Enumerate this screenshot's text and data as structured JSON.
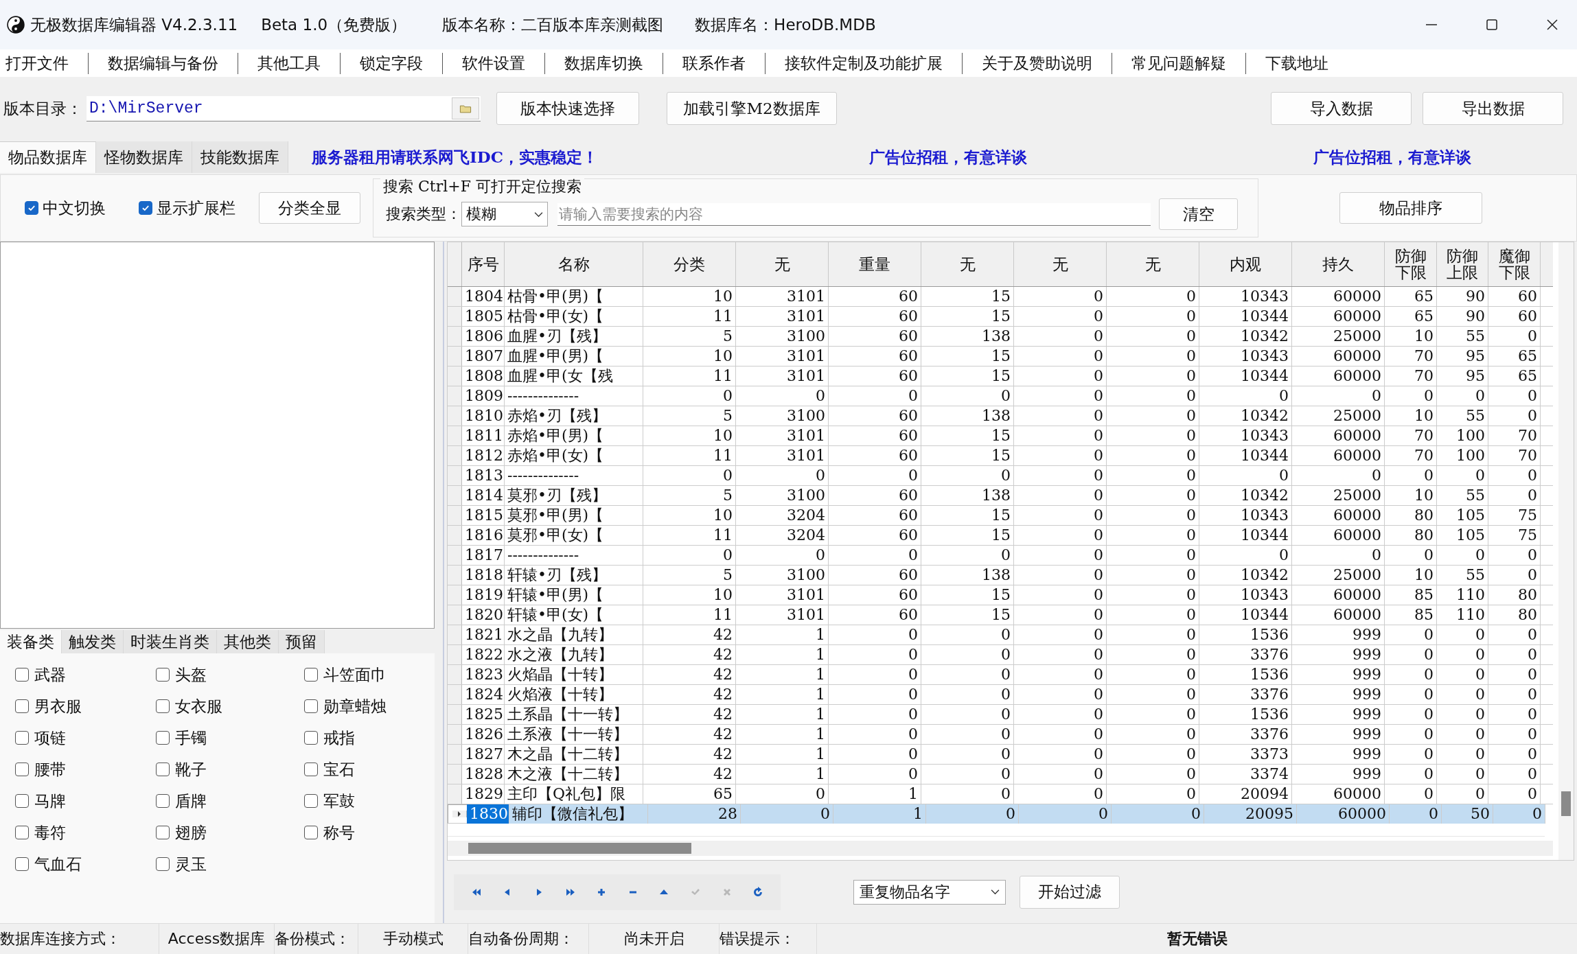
{
  "window": {
    "title": "无极数据库编辑器 V4.2.3.11",
    "edition": "Beta 1.0（免费版）",
    "version_name": "版本名称：二百版本库亲测截图",
    "database_name": "数据库名：HeroDB.MDB"
  },
  "menu": [
    "打开文件",
    "数据编辑与备份",
    "其他工具",
    "锁定字段",
    "软件设置",
    "数据库切换",
    "联系作者",
    "接软件定制及功能扩展",
    "关于及赞助说明",
    "常见问题解疑",
    "下载地址"
  ],
  "path_bar": {
    "label": "版本目录：",
    "value": "D:\\MirServer",
    "quick_select_button": "版本快速选择",
    "load_button": "加载引擎M2数据库",
    "import_button": "导入数据",
    "export_button": "导出数据"
  },
  "tabs": [
    {
      "label": "物品数据库",
      "selected": true
    },
    {
      "label": "怪物数据库",
      "selected": false
    },
    {
      "label": "技能数据库",
      "selected": false
    }
  ],
  "ads": [
    "服务器租用请联系网飞IDC，实惠稳定！",
    "广告位招租，有意详谈",
    "广告位招租，有意详谈"
  ],
  "options": {
    "checkboxes": [
      {
        "label": "中文切换",
        "checked": true
      },
      {
        "label": "显示扩展栏",
        "checked": true
      }
    ],
    "show_all_button": "分类全显"
  },
  "search": {
    "title": "搜索  Ctrl+F 可打开定位搜索",
    "type_label": "搜索类型：",
    "type_value": "模糊",
    "placeholder": "请输入需要搜索的内容",
    "clear_button": "清空"
  },
  "sort_button": "物品排序",
  "category_tabs": [
    {
      "label": "装备类",
      "selected": true
    },
    {
      "label": "触发类",
      "selected": false
    },
    {
      "label": "时装生肖类",
      "selected": false
    },
    {
      "label": "其他类",
      "selected": false
    },
    {
      "label": "预留",
      "selected": false
    }
  ],
  "categories": [
    {
      "label": "武器",
      "checked": false
    },
    {
      "label": "头盔",
      "checked": false
    },
    {
      "label": "斗笠面巾",
      "checked": false
    },
    {
      "label": "男衣服",
      "checked": false
    },
    {
      "label": "女衣服",
      "checked": false
    },
    {
      "label": "勋章蜡烛",
      "checked": false
    },
    {
      "label": "项链",
      "checked": false
    },
    {
      "label": "手镯",
      "checked": false
    },
    {
      "label": "戒指",
      "checked": false
    },
    {
      "label": "腰带",
      "checked": false
    },
    {
      "label": "靴子",
      "checked": false
    },
    {
      "label": "宝石",
      "checked": false
    },
    {
      "label": "马牌",
      "checked": false
    },
    {
      "label": "盾牌",
      "checked": false
    },
    {
      "label": "军鼓",
      "checked": false
    },
    {
      "label": "毒符",
      "checked": false
    },
    {
      "label": "翅膀",
      "checked": false
    },
    {
      "label": "称号",
      "checked": false
    },
    {
      "label": "气血石",
      "checked": false
    },
    {
      "label": "灵玉",
      "checked": false
    }
  ],
  "table": {
    "columns": [
      "序号",
      "名称",
      "分类",
      "无",
      "重量",
      "无",
      "无",
      "无",
      "内观",
      "持久",
      "防御下限",
      "防御上限",
      "魔御下限"
    ],
    "rows": [
      {
        "selected": false,
        "cells": [
          "1804",
          "枯骨•甲(男)【",
          "10",
          "3101",
          "60",
          "15",
          "0",
          "0",
          "10343",
          "60000",
          "65",
          "90",
          "60"
        ]
      },
      {
        "selected": false,
        "cells": [
          "1805",
          "枯骨•甲(女)【",
          "11",
          "3101",
          "60",
          "15",
          "0",
          "0",
          "10344",
          "60000",
          "65",
          "90",
          "60"
        ]
      },
      {
        "selected": false,
        "cells": [
          "1806",
          "血腥•刃【残】",
          "5",
          "3100",
          "60",
          "138",
          "0",
          "0",
          "10342",
          "25000",
          "10",
          "55",
          "0"
        ]
      },
      {
        "selected": false,
        "cells": [
          "1807",
          "血腥•甲(男)【",
          "10",
          "3101",
          "60",
          "15",
          "0",
          "0",
          "10343",
          "60000",
          "70",
          "95",
          "65"
        ]
      },
      {
        "selected": false,
        "cells": [
          "1808",
          "血腥•甲(女【残",
          "11",
          "3101",
          "60",
          "15",
          "0",
          "0",
          "10344",
          "60000",
          "70",
          "95",
          "65"
        ]
      },
      {
        "selected": false,
        "cells": [
          "1809",
          "--------------",
          "0",
          "0",
          "0",
          "0",
          "0",
          "0",
          "0",
          "0",
          "0",
          "0",
          "0"
        ]
      },
      {
        "selected": false,
        "cells": [
          "1810",
          "赤焰•刃【残】",
          "5",
          "3100",
          "60",
          "138",
          "0",
          "0",
          "10342",
          "25000",
          "10",
          "55",
          "0"
        ]
      },
      {
        "selected": false,
        "cells": [
          "1811",
          "赤焰•甲(男)【",
          "10",
          "3101",
          "60",
          "15",
          "0",
          "0",
          "10343",
          "60000",
          "70",
          "100",
          "70"
        ]
      },
      {
        "selected": false,
        "cells": [
          "1812",
          "赤焰•甲(女)【",
          "11",
          "3101",
          "60",
          "15",
          "0",
          "0",
          "10344",
          "60000",
          "70",
          "100",
          "70"
        ]
      },
      {
        "selected": false,
        "cells": [
          "1813",
          "--------------",
          "0",
          "0",
          "0",
          "0",
          "0",
          "0",
          "0",
          "0",
          "0",
          "0",
          "0"
        ]
      },
      {
        "selected": false,
        "cells": [
          "1814",
          "莫邪•刃【残】",
          "5",
          "3100",
          "60",
          "138",
          "0",
          "0",
          "10342",
          "25000",
          "10",
          "55",
          "0"
        ]
      },
      {
        "selected": false,
        "cells": [
          "1815",
          "莫邪•甲(男)【",
          "10",
          "3204",
          "60",
          "15",
          "0",
          "0",
          "10343",
          "60000",
          "80",
          "105",
          "75"
        ]
      },
      {
        "selected": false,
        "cells": [
          "1816",
          "莫邪•甲(女)【",
          "11",
          "3204",
          "60",
          "15",
          "0",
          "0",
          "10344",
          "60000",
          "80",
          "105",
          "75"
        ]
      },
      {
        "selected": false,
        "cells": [
          "1817",
          "--------------",
          "0",
          "0",
          "0",
          "0",
          "0",
          "0",
          "0",
          "0",
          "0",
          "0",
          "0"
        ]
      },
      {
        "selected": false,
        "cells": [
          "1818",
          "轩辕•刃【残】",
          "5",
          "3100",
          "60",
          "138",
          "0",
          "0",
          "10342",
          "25000",
          "10",
          "55",
          "0"
        ]
      },
      {
        "selected": false,
        "cells": [
          "1819",
          "轩辕•甲(男)【",
          "10",
          "3101",
          "60",
          "15",
          "0",
          "0",
          "10343",
          "60000",
          "85",
          "110",
          "80"
        ]
      },
      {
        "selected": false,
        "cells": [
          "1820",
          "轩辕•甲(女)【",
          "11",
          "3101",
          "60",
          "15",
          "0",
          "0",
          "10344",
          "60000",
          "85",
          "110",
          "80"
        ]
      },
      {
        "selected": false,
        "cells": [
          "1821",
          "水之晶【九转】",
          "42",
          "1",
          "0",
          "0",
          "0",
          "0",
          "1536",
          "999",
          "0",
          "0",
          "0"
        ]
      },
      {
        "selected": false,
        "cells": [
          "1822",
          "水之液【九转】",
          "42",
          "1",
          "0",
          "0",
          "0",
          "0",
          "3376",
          "999",
          "0",
          "0",
          "0"
        ]
      },
      {
        "selected": false,
        "cells": [
          "1823",
          "火焰晶【十转】",
          "42",
          "1",
          "0",
          "0",
          "0",
          "0",
          "1536",
          "999",
          "0",
          "0",
          "0"
        ]
      },
      {
        "selected": false,
        "cells": [
          "1824",
          "火焰液【十转】",
          "42",
          "1",
          "0",
          "0",
          "0",
          "0",
          "3376",
          "999",
          "0",
          "0",
          "0"
        ]
      },
      {
        "selected": false,
        "cells": [
          "1825",
          "土系晶【十一转】",
          "42",
          "1",
          "0",
          "0",
          "0",
          "0",
          "1536",
          "999",
          "0",
          "0",
          "0"
        ]
      },
      {
        "selected": false,
        "cells": [
          "1826",
          "土系液【十一转】",
          "42",
          "1",
          "0",
          "0",
          "0",
          "0",
          "3376",
          "999",
          "0",
          "0",
          "0"
        ]
      },
      {
        "selected": false,
        "cells": [
          "1827",
          "木之晶【十二转】",
          "42",
          "1",
          "0",
          "0",
          "0",
          "0",
          "3373",
          "999",
          "0",
          "0",
          "0"
        ]
      },
      {
        "selected": false,
        "cells": [
          "1828",
          "木之液【十二转】",
          "42",
          "1",
          "0",
          "0",
          "0",
          "0",
          "3374",
          "999",
          "0",
          "0",
          "0"
        ]
      },
      {
        "selected": false,
        "cells": [
          "1829",
          "主印【Q礼包】限",
          "65",
          "0",
          "1",
          "0",
          "0",
          "0",
          "20094",
          "60000",
          "0",
          "0",
          "0"
        ]
      },
      {
        "selected": true,
        "cells": [
          "1830",
          "辅印【微信礼包】",
          "28",
          "0",
          "1",
          "0",
          "0",
          "0",
          "20095",
          "60000",
          "0",
          "50",
          "0"
        ]
      }
    ]
  },
  "nav_buttons": [
    {
      "kind": "first",
      "disabled": false
    },
    {
      "kind": "prior",
      "disabled": false
    },
    {
      "kind": "next",
      "disabled": false
    },
    {
      "kind": "last",
      "disabled": false
    },
    {
      "kind": "insert",
      "disabled": false
    },
    {
      "kind": "delete",
      "disabled": false
    },
    {
      "kind": "edit",
      "disabled": false
    },
    {
      "kind": "post",
      "disabled": true
    },
    {
      "kind": "cancel",
      "disabled": true
    },
    {
      "kind": "refresh",
      "disabled": false
    }
  ],
  "filter": {
    "value": "重复物品名字",
    "button": "开始过滤"
  },
  "status_bar": [
    {
      "label": "数据库连接方式：",
      "value": "Access数据库"
    },
    {
      "label": "备份模式：",
      "value": "手动模式"
    },
    {
      "label": "自动备份周期：",
      "value": "尚未开启"
    },
    {
      "label": "错误提示：",
      "value": "暂无错误"
    }
  ]
}
